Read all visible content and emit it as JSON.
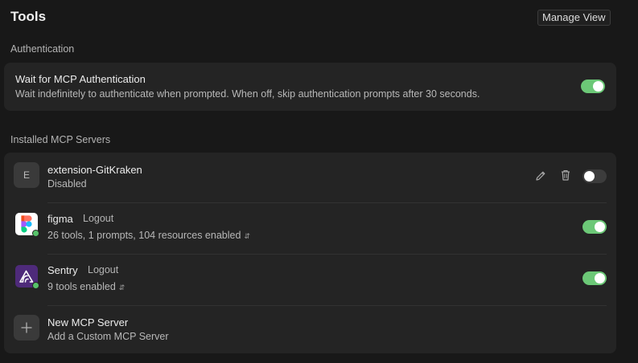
{
  "header": {
    "title": "Tools",
    "manage_view_label": "Manage View"
  },
  "authentication": {
    "section_label": "Authentication",
    "setting_title": "Wait for MCP Authentication",
    "setting_description": "Wait indefinitely to authenticate when prompted. When off, skip authentication prompts after 30 seconds.",
    "enabled": true
  },
  "installed": {
    "section_label": "Installed MCP Servers",
    "servers": [
      {
        "name": "extension-GitKraken",
        "avatar_letter": "E",
        "subtitle": "Disabled",
        "enabled": false,
        "actions": [
          "pencil-icon",
          "trash-icon"
        ]
      },
      {
        "name": "figma",
        "logout_label": "Logout",
        "subtitle": "26 tools, 1 prompts, 104 resources enabled",
        "icon": "figma-logo",
        "connected": true,
        "enabled": true
      },
      {
        "name": "Sentry",
        "logout_label": "Logout",
        "subtitle": "9 tools enabled",
        "icon": "sentry-logo",
        "connected": true,
        "enabled": true
      }
    ],
    "new_server": {
      "title": "New MCP Server",
      "subtitle": "Add a Custom MCP Server",
      "icon": "plus-icon"
    }
  },
  "colors": {
    "background": "#181818",
    "card": "#242424",
    "toggle_on": "#6cc877",
    "status_connected": "#57c36a"
  }
}
